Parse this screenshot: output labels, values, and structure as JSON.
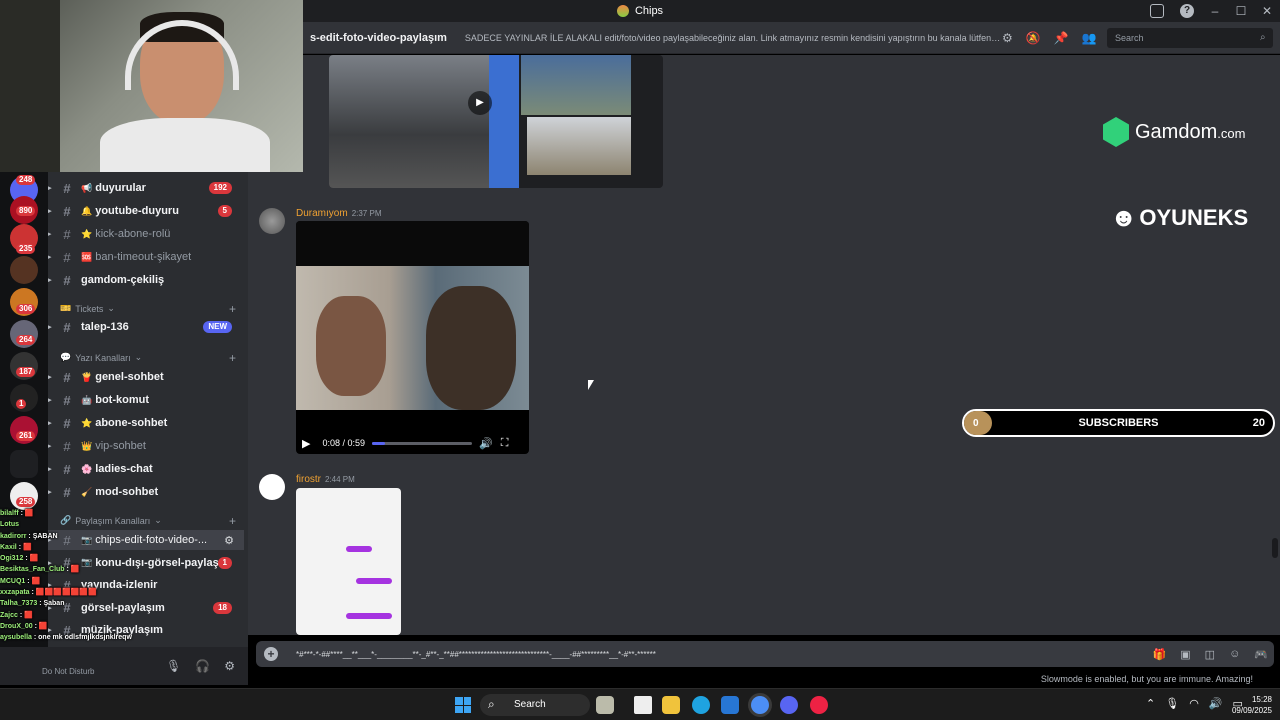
{
  "window": {
    "title": "Chips"
  },
  "header": {
    "channel": "s-edit-foto-video-paylaşım",
    "topic": "SADECE YAYINLAR İLE ALAKALI edit/foto/video paylaşabileceğiniz alan. Link atmayınız resmin kendisini yapıştırın bu kanala lütfen, ...",
    "search_placeholder": "Search"
  },
  "rail_counts": [
    "248",
    "890",
    "235",
    "306",
    "264",
    "187",
    "1",
    "261",
    "258"
  ],
  "sidebar": {
    "channels": [
      {
        "emoji": "📢",
        "label": "duyurular",
        "badge": "192",
        "bold": true
      },
      {
        "emoji": "🔔",
        "label": "youtube-duyuru",
        "badge": "5",
        "bold": true
      },
      {
        "emoji": "⭐",
        "label": "kick-abone-rolü",
        "bold": false
      },
      {
        "emoji": "🆘",
        "label": "ban-timeout-şikayet",
        "bold": false
      },
      {
        "emoji": "",
        "label": "gamdom-çekiliş",
        "bold": true
      }
    ],
    "cat_tickets": "Tickets",
    "ticket_channel": {
      "label": "talep-136",
      "badge": "NEW"
    },
    "cat_text": "Yazı Kanalları",
    "text_channels": [
      {
        "emoji": "🍟",
        "label": "genel-sohbet",
        "bold": true
      },
      {
        "emoji": "🤖",
        "label": "bot-komut",
        "bold": true
      },
      {
        "emoji": "⭐",
        "label": "abone-sohbet",
        "bold": true
      },
      {
        "emoji": "👑",
        "label": "vip-sohbet",
        "bold": false
      },
      {
        "emoji": "🌸",
        "label": "ladies-chat",
        "bold": true
      },
      {
        "emoji": "🧹",
        "label": "mod-sohbet",
        "bold": true
      }
    ],
    "cat_share": "Paylaşım Kanalları",
    "share_channels": [
      {
        "emoji": "📷",
        "label": "chips-edit-foto-video-...",
        "active": true
      },
      {
        "emoji": "📷",
        "label": "konu-dışı-görsel-paylaşım",
        "badge": "1",
        "bold": true
      },
      {
        "emoji": "",
        "label": "yayında-izlenir",
        "bold": true
      },
      {
        "emoji": "",
        "label": "görsel-paylaşım",
        "badge": "18",
        "bold": true
      },
      {
        "emoji": "",
        "label": "müzik-paylaşım",
        "bold": true
      }
    ]
  },
  "user_panel": {
    "status": "Do Not Disturb"
  },
  "messages": [
    {
      "author": "Duramıyom",
      "time": "2:37 PM",
      "color": "#f0a232",
      "video_time": "0:08 / 0:59",
      "video_progress": 0.13
    },
    {
      "author": "firostr",
      "time": "2:44 PM",
      "color": "#f0a232"
    }
  ],
  "composer": {
    "text": "*#***-*-##****__**___*-________**-_#**-_**##*****************************-____-##*********__*-#**-******"
  },
  "slowmode": "Slowmode is enabled, but you are immune. Amazing!",
  "overlays": {
    "gamdom_brand": "Gamdom",
    "gamdom_tld": ".com",
    "oyuneks_brand": "OYUNEKS",
    "subs_current": "0",
    "subs_label": "SUBSCRIBERS",
    "subs_goal": "20",
    "subs_progress": 0
  },
  "stream_chat": [
    {
      "user": "bilalff",
      "msg": ": 🟥"
    },
    {
      "user": "Lotus",
      "msg": ""
    },
    {
      "user": "kadirorr",
      "msg": ": ŞABAN"
    },
    {
      "user": "Kaxil",
      "msg": ": 🟥"
    },
    {
      "user": "Ogi312",
      "msg": ": 🟥"
    },
    {
      "user": "Besiktas_Fan_Club",
      "msg": ": 🟥"
    },
    {
      "user": "MCUQ1",
      "msg": ": 🟥"
    },
    {
      "user": "xxzapata",
      "msg": ": 🟥🟥🟥🟥🟥🟥🟥"
    },
    {
      "user": "Talha_7373",
      "msg": ": Şaban"
    },
    {
      "user": "Zajcc",
      "msg": ": 🟥"
    },
    {
      "user": "DrouX_00",
      "msg": ": 🟥"
    },
    {
      "user": "aysubella",
      "msg": ": one mk odlsfmjlkdsjnklreqw"
    }
  ],
  "taskbar": {
    "search": "Search",
    "time": "15:28",
    "date": "09/09/2025"
  }
}
